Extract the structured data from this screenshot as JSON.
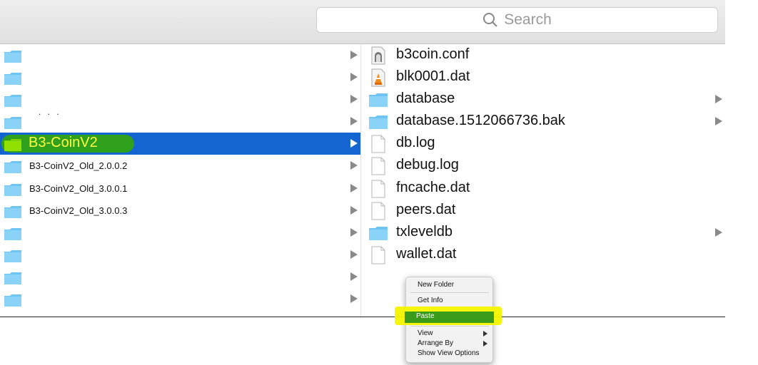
{
  "search": {
    "placeholder": "Search"
  },
  "sidebar_column": {
    "rows": [
      {
        "label": ""
      },
      {
        "label": ""
      },
      {
        "label": ""
      },
      {
        "label": ""
      },
      {
        "label": "B3-CoinV2",
        "selected": true
      },
      {
        "label": "B3-CoinV2_Old_2.0.0.2"
      },
      {
        "label": "B3-CoinV2_Old_3.0.0.1"
      },
      {
        "label": "B3-CoinV2_Old_3.0.0.3"
      },
      {
        "label": ""
      },
      {
        "label": ""
      },
      {
        "label": ""
      },
      {
        "label": ""
      }
    ],
    "dots": ". . ."
  },
  "content_column": {
    "items": [
      {
        "name": "b3coin.conf",
        "kind": "conf-icon"
      },
      {
        "name": "blk0001.dat",
        "kind": "vlc-icon"
      },
      {
        "name": "database",
        "kind": "folder-icon"
      },
      {
        "name": "database.1512066736.bak",
        "kind": "folder-icon"
      },
      {
        "name": "db.log",
        "kind": "document-icon"
      },
      {
        "name": "debug.log",
        "kind": "document-icon"
      },
      {
        "name": "fncache.dat",
        "kind": "document-icon"
      },
      {
        "name": "peers.dat",
        "kind": "document-icon"
      },
      {
        "name": "txleveldb",
        "kind": "folder-icon"
      },
      {
        "name": "wallet.dat",
        "kind": "document-icon"
      }
    ]
  },
  "context_menu": {
    "new_folder": "New Folder",
    "get_info": "Get Info",
    "paste": "Paste",
    "view": "View",
    "arrange_by": "Arrange By",
    "show_view_options": "Show View Options"
  },
  "colors": {
    "selection": "#1464d2",
    "highlight_yellow": "#f6f600",
    "highlight_green": "#2fa01c",
    "folder_blue": "#6ec4f2"
  }
}
